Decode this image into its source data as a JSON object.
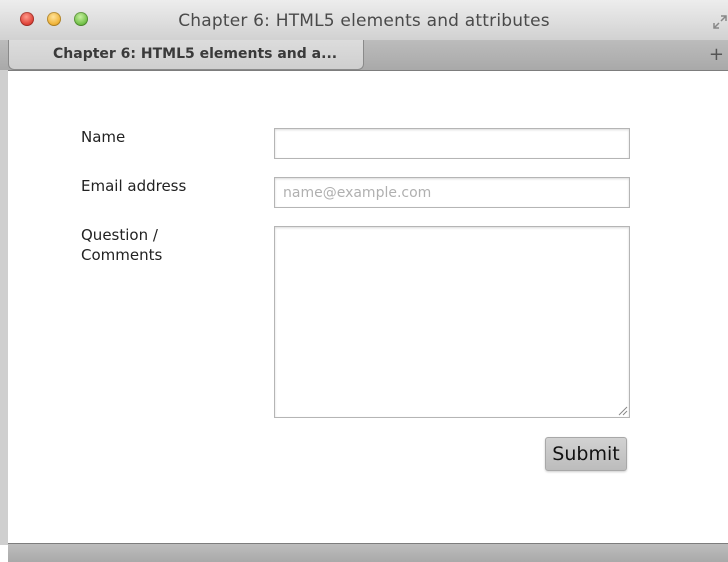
{
  "window": {
    "title": "Chapter 6: HTML5 elements and attributes"
  },
  "tabs": [
    {
      "label": "Chapter 6: HTML5 elements and a..."
    }
  ],
  "tabbar": {
    "add_label": "+"
  },
  "form": {
    "name": {
      "label": "Name",
      "value": "",
      "placeholder": ""
    },
    "email": {
      "label": "Email address",
      "value": "",
      "placeholder": "name@example.com"
    },
    "comments": {
      "label_line1": "Question /",
      "label_line2": "Comments",
      "value": ""
    },
    "submit_label": "Submit"
  },
  "colors": {
    "close": "#e0443a",
    "minimize": "#f0b43a",
    "zoom": "#74c24a"
  }
}
